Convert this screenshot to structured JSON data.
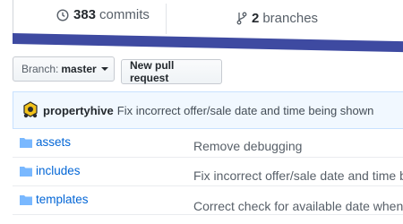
{
  "stats": {
    "commits": {
      "count": "383",
      "label": "commits",
      "icon": "history-icon"
    },
    "branches": {
      "count": "2",
      "label": "branches",
      "icon": "branch-icon"
    }
  },
  "language_bar": {
    "color": "#3e4aa1"
  },
  "branch_select": {
    "prefix": "Branch:",
    "value": "master"
  },
  "new_pr_label": "New pull request",
  "latest_commit": {
    "author": "propertyhive",
    "message": "Fix incorrect offer/sale date and time being shown"
  },
  "files": [
    {
      "name": "assets",
      "type": "folder",
      "message": "Remove debugging"
    },
    {
      "name": "includes",
      "type": "folder",
      "message": "Fix incorrect offer/sale date and time b"
    },
    {
      "name": "templates",
      "type": "folder",
      "message": "Correct check for available date when a"
    }
  ],
  "colors": {
    "link": "#0366d6",
    "folder": "#79b8ff",
    "tease_bg": "#f1f8ff"
  }
}
